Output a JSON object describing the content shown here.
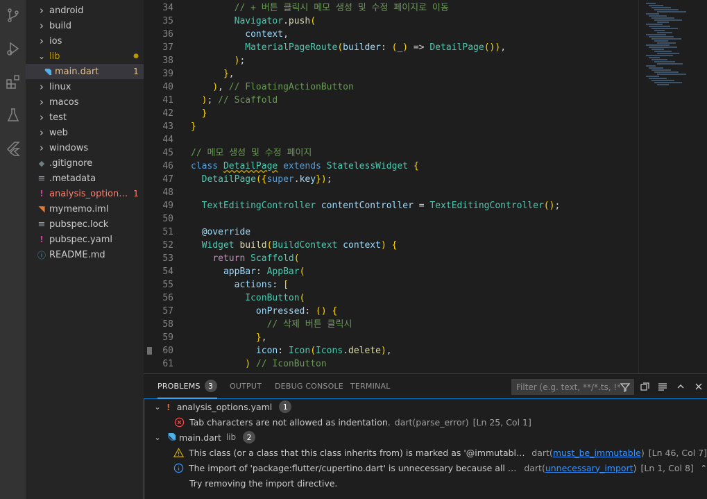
{
  "explorer": {
    "items": [
      {
        "label": "android",
        "type": "folder",
        "badge": ""
      },
      {
        "label": "build",
        "type": "folder",
        "badge": ""
      },
      {
        "label": "ios",
        "type": "folder",
        "badge": ""
      },
      {
        "label": "lib",
        "type": "folder-open",
        "badge": "●"
      },
      {
        "label": "main.dart",
        "type": "dart",
        "badge": "1"
      },
      {
        "label": "linux",
        "type": "folder",
        "badge": ""
      },
      {
        "label": "macos",
        "type": "folder",
        "badge": ""
      },
      {
        "label": "test",
        "type": "folder",
        "badge": ""
      },
      {
        "label": "web",
        "type": "folder",
        "badge": ""
      },
      {
        "label": "windows",
        "type": "folder",
        "badge": ""
      },
      {
        "label": ".gitignore",
        "type": "git",
        "badge": ""
      },
      {
        "label": ".metadata",
        "type": "file",
        "badge": ""
      },
      {
        "label": "analysis_options.yaml",
        "type": "warn",
        "badge": "1"
      },
      {
        "label": "mymemo.iml",
        "type": "rss",
        "badge": ""
      },
      {
        "label": "pubspec.lock",
        "type": "file",
        "badge": ""
      },
      {
        "label": "pubspec.yaml",
        "type": "warn",
        "badge": ""
      },
      {
        "label": "README.md",
        "type": "info",
        "badge": ""
      }
    ],
    "colors": {
      "modified": "#e2c08d",
      "error": "#f88070",
      "folder_mod": "#b89500"
    }
  },
  "editor": {
    "lines": [
      {
        "n": "34",
        "t": "        // + 버튼 클릭시 메모 생성 및 수정 페이지로 이동"
      },
      {
        "n": "35",
        "t": "        Navigator.push("
      },
      {
        "n": "36",
        "t": "          context,"
      },
      {
        "n": "37",
        "t": "          MaterialPageRoute(builder: (_) => DetailPage()),"
      },
      {
        "n": "38",
        "t": "        );"
      },
      {
        "n": "39",
        "t": "      },"
      },
      {
        "n": "40",
        "t": "    ), // FloatingActionButton"
      },
      {
        "n": "41",
        "t": "  ); // Scaffold"
      },
      {
        "n": "42",
        "t": "  }"
      },
      {
        "n": "43",
        "t": "}"
      },
      {
        "n": "44",
        "t": ""
      },
      {
        "n": "45",
        "t": "// 메모 생성 및 수정 페이지"
      },
      {
        "n": "46",
        "t": "class DetailPage extends StatelessWidget {"
      },
      {
        "n": "47",
        "t": "  DetailPage({super.key});"
      },
      {
        "n": "48",
        "t": ""
      },
      {
        "n": "49",
        "t": "  TextEditingController contentController = TextEditingController();"
      },
      {
        "n": "50",
        "t": ""
      },
      {
        "n": "51",
        "t": "  @override"
      },
      {
        "n": "52",
        "t": "  Widget build(BuildContext context) {"
      },
      {
        "n": "53",
        "t": "    return Scaffold("
      },
      {
        "n": "54",
        "t": "      appBar: AppBar("
      },
      {
        "n": "55",
        "t": "        actions: ["
      },
      {
        "n": "56",
        "t": "          IconButton("
      },
      {
        "n": "57",
        "t": "            onPressed: () {"
      },
      {
        "n": "58",
        "t": "              // 삭제 버튼 클릭시"
      },
      {
        "n": "59",
        "t": "            },"
      },
      {
        "n": "60",
        "t": "            icon: Icon(Icons.delete),"
      },
      {
        "n": "61",
        "t": "          ) // IconButton"
      }
    ]
  },
  "panel": {
    "tabs": [
      {
        "label": "PROBLEMS",
        "count": "3",
        "active": true
      },
      {
        "label": "OUTPUT",
        "count": "",
        "active": false
      },
      {
        "label": "DEBUG CONSOLE",
        "count": "",
        "active": false
      },
      {
        "label": "TERMINAL",
        "count": "",
        "active": false
      }
    ],
    "filter_placeholder": "Filter (e.g. text, **/*.ts, !**/...",
    "groups": [
      {
        "file": "analysis_options.yaml",
        "dir": "",
        "count": "1",
        "icon": "warn",
        "problems": [
          {
            "severity": "error",
            "message": "Tab characters are not allowed as indentation.",
            "source": "dart(parse_error)",
            "code": "",
            "location": "[Ln 25, Col 1]"
          }
        ]
      },
      {
        "file": "main.dart",
        "dir": "lib",
        "count": "2",
        "icon": "dart",
        "problems": [
          {
            "severity": "warning",
            "message": "This class (or a class that this class inherits from) is marked as '@immutable', but one o...",
            "source": "dart(",
            "code": "must_be_immutable",
            "location": "[Ln 46, Col 7]"
          },
          {
            "severity": "info",
            "message": "The import of 'package:flutter/cupertino.dart' is unnecessary because all of the used ...",
            "source": "dart(",
            "code": "unnecessary_import",
            "location": "[Ln 1, Col 8]"
          }
        ]
      }
    ],
    "hint": "Try removing the import directive."
  }
}
